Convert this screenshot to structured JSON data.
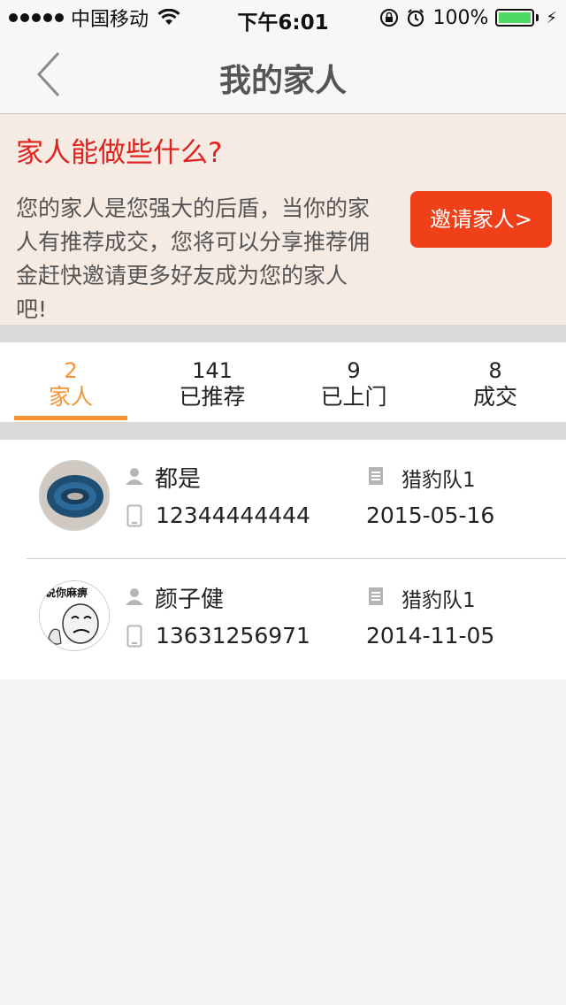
{
  "status_bar": {
    "carrier": "中国移动",
    "time": "下午6:01",
    "battery": "100%"
  },
  "nav": {
    "title": "我的家人",
    "back_icon": "chevron-left-icon"
  },
  "banner": {
    "title": "家人能做些什么?",
    "text": "您的家人是您强大的后盾，当你的家人有推荐成交，您将可以分享推荐佣金赶快邀请更多好友成为您的家人吧!",
    "invite_label": "邀请家人>"
  },
  "tabs": [
    {
      "count": "2",
      "label": "家人",
      "active": true
    },
    {
      "count": "141",
      "label": "已推荐",
      "active": false
    },
    {
      "count": "9",
      "label": "已上门",
      "active": false
    },
    {
      "count": "8",
      "label": "成交",
      "active": false
    }
  ],
  "members": [
    {
      "name": "都是",
      "phone": "12344444444",
      "team": "猎豹队1",
      "date": "2015-05-16"
    },
    {
      "name": "颜子健",
      "phone": "13631256971",
      "team": "猎豹队1",
      "date": "2014-11-05"
    }
  ],
  "colors": {
    "accent": "#f79332",
    "banner_title": "#e0221f",
    "invite_button": "#f0401a",
    "banner_bg": "#f6ebe3"
  },
  "avatar2_caption": "说你麻痹"
}
